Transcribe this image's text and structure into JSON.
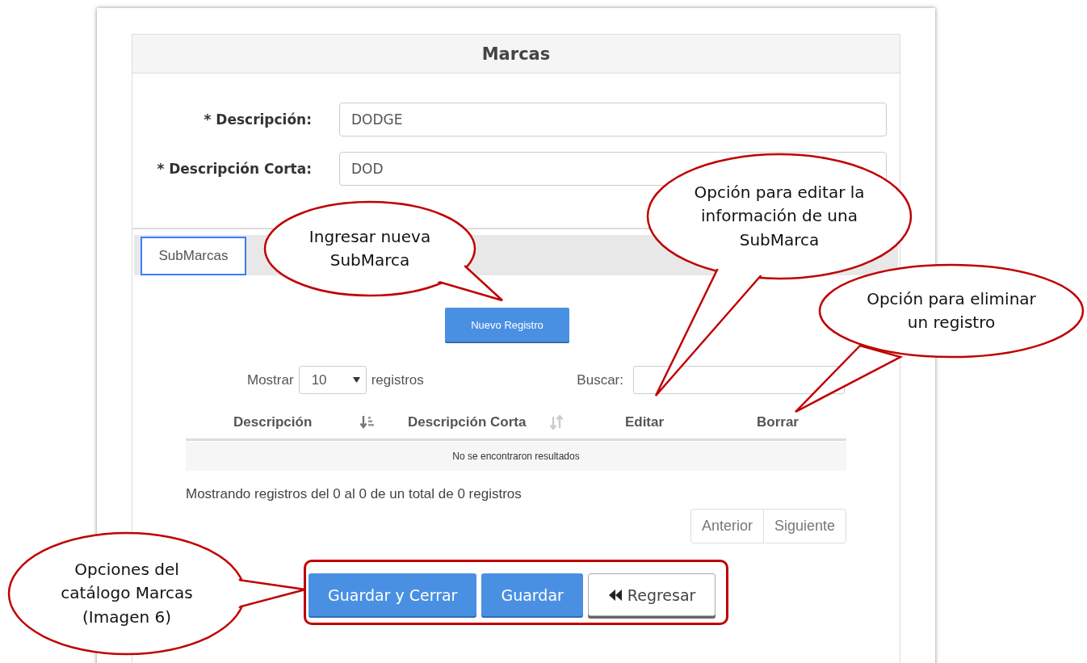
{
  "panel": {
    "title": "Marcas"
  },
  "fields": [
    {
      "label": "* Descripción:",
      "value": "DODGE"
    },
    {
      "label": "* Descripción Corta:",
      "value": "DOD"
    }
  ],
  "tabs": [
    {
      "label": "SubMarcas",
      "selected": true
    }
  ],
  "new_button": "Nuevo Registro",
  "table_controls": {
    "show_label": "Mostrar",
    "page_size": "10",
    "records_label": "registros",
    "search_label": "Buscar:"
  },
  "table": {
    "columns": [
      {
        "label": "Descripción",
        "sorted": true
      },
      {
        "label": "Descripción Corta",
        "sorted": false
      },
      {
        "label": "Editar"
      },
      {
        "label": "Borrar"
      }
    ],
    "empty_message": "No se encontraron resultados"
  },
  "info": "Mostrando registros del 0 al 0 de un total de 0 registros",
  "pagination": [
    "Anterior",
    "Siguiente"
  ],
  "actions": [
    {
      "label": "Guardar y Cerrar",
      "kind": "primary"
    },
    {
      "label": "Guardar",
      "kind": "primary"
    },
    {
      "label": "Regresar",
      "kind": "back"
    }
  ],
  "callouts": [
    {
      "lines": [
        "Ingresar nueva",
        "SubMarca"
      ]
    },
    {
      "lines": [
        "Opción para editar la",
        "información de una",
        "SubMarca"
      ]
    },
    {
      "lines": [
        "Opción para eliminar",
        "un registro"
      ]
    },
    {
      "lines": [
        "Opciones del",
        "catálogo Marcas",
        "(Imagen 6)"
      ]
    }
  ]
}
